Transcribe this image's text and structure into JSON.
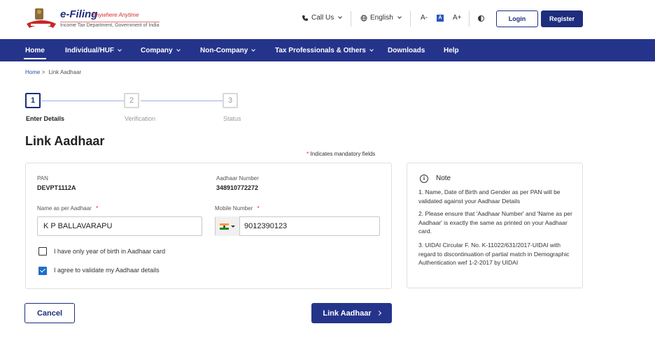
{
  "header": {
    "logo_title": "e-Filing",
    "logo_tagline": "Anywhere Anytime",
    "logo_subtitle": "Income Tax Department, Government of India",
    "call_us": "Call Us",
    "language": "English",
    "font_decrease": "A-",
    "font_normal": "A",
    "font_increase": "A+",
    "login": "Login",
    "register": "Register"
  },
  "nav": {
    "items": [
      {
        "label": "Home"
      },
      {
        "label": "Individual/HUF"
      },
      {
        "label": "Company"
      },
      {
        "label": "Non-Company"
      },
      {
        "label": "Tax Professionals & Others"
      },
      {
        "label": "Downloads"
      },
      {
        "label": "Help"
      }
    ]
  },
  "breadcrumb": {
    "home": "Home",
    "separator": ">",
    "current": "Link Aadhaar"
  },
  "stepper": {
    "steps": [
      {
        "number": "1",
        "label": "Enter Details"
      },
      {
        "number": "2",
        "label": "Verification"
      },
      {
        "number": "3",
        "label": "Status"
      }
    ],
    "active_step": 1
  },
  "page": {
    "title": "Link Aadhaar",
    "mandatory_star": "*",
    "mandatory_text": "Indicates mandatory fields"
  },
  "form": {
    "pan_label": "PAN",
    "pan_value": "DEVPT1112A",
    "aadhaar_label": "Aadhaar Number",
    "aadhaar_value": "348910772272",
    "name_label": "Name as per Aadhaar",
    "name_value": "K P BALLAVARAPU",
    "mobile_label": "Mobile Number",
    "mobile_value": "9012390123",
    "required_mark": "*",
    "checkbox_yob_label": "I have only year of birth in Aadhaar card",
    "checkbox_yob_checked": false,
    "checkbox_agree_label": "I agree to validate my Aadhaar details",
    "checkbox_agree_checked": true
  },
  "note": {
    "icon": "i",
    "title": "Note",
    "points": [
      "1. Name, Date of Birth and Gender as per PAN will be validated against your Aadhaar Details",
      "2. Please ensure that 'Aadhaar Number' and 'Name as per Aadhaar' is exactly the same as printed on your Aadhaar card.",
      "3. UIDAI Circular F. No. K-11022/631/2017-UIDAI with regard to discontinuation of partial match in Demographic Authentication wef 1-2-2017 by UIDAI"
    ]
  },
  "actions": {
    "cancel": "Cancel",
    "link": "Link Aadhaar"
  },
  "colors": {
    "primary": "#25348b",
    "nav_bg": "#25348b",
    "required": "#d32f2f",
    "checkbox_checked": "#1f6fc9"
  }
}
